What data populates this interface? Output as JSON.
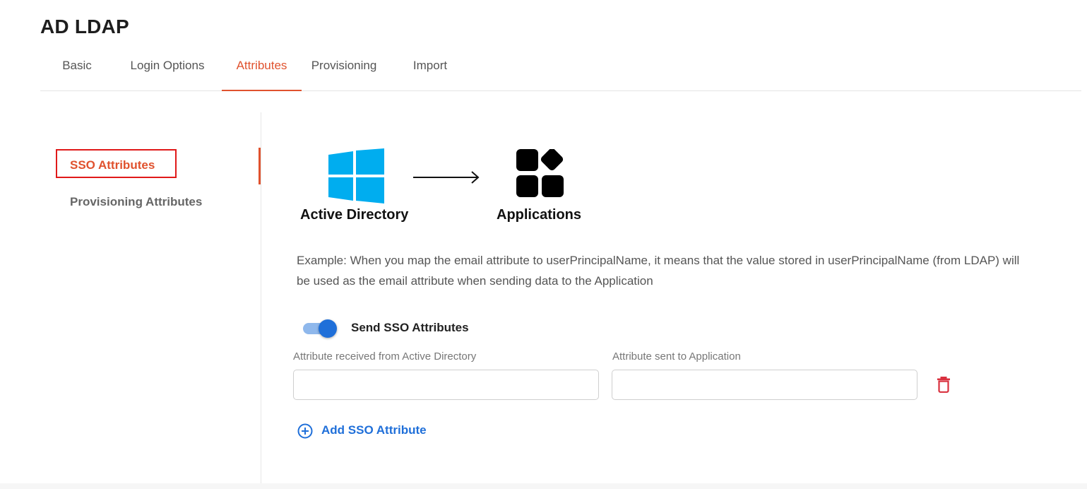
{
  "page_title": "AD LDAP",
  "tabs": [
    {
      "label": "Basic",
      "active": false
    },
    {
      "label": "Login Options",
      "active": false
    },
    {
      "label": "Attributes",
      "active": true
    },
    {
      "label": "Provisioning",
      "active": false
    },
    {
      "label": "Import",
      "active": false
    }
  ],
  "sidebar": {
    "items": [
      {
        "label": "SSO Attributes",
        "active": true
      },
      {
        "label": "Provisioning Attributes",
        "active": false
      }
    ]
  },
  "diagram": {
    "source_label": "Active Directory",
    "source_icon": "windows-logo-icon",
    "arrow_icon": "arrow-right-icon",
    "target_label": "Applications",
    "target_icon": "apps-grid-icon",
    "source_color": "#00adef",
    "target_color": "#000000"
  },
  "description": "Example: When you map the email attribute to userPrincipalName, it means that the value stored in userPrincipalName (from LDAP) will be used as the email attribute when sending data to the Application",
  "sso_toggle": {
    "label": "Send SSO Attributes",
    "enabled": true
  },
  "attribute_mapping": {
    "source_label": "Attribute received from Active Directory",
    "target_label": "Attribute sent to Application",
    "rows": [
      {
        "source_value": "",
        "target_value": ""
      }
    ]
  },
  "add_button_label": "Add SSO Attribute",
  "colors": {
    "accent": "#e0522e",
    "primary_blue": "#1f6fd9",
    "delete_red": "#d9303e",
    "highlight_box": "#e01919"
  }
}
